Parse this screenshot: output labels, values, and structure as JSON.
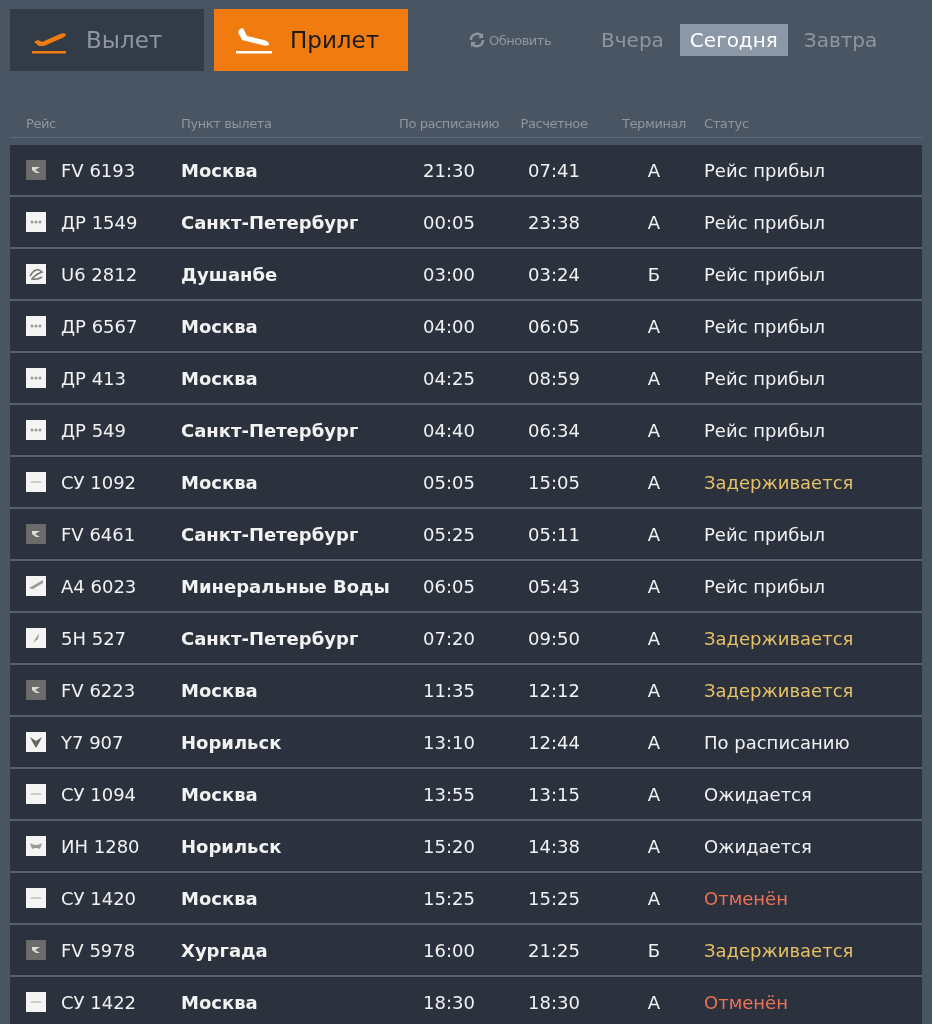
{
  "direction_tabs": [
    {
      "label": "Вылет",
      "kind": "departure",
      "selected": false
    },
    {
      "label": "Прилет",
      "kind": "arrival",
      "selected": true
    }
  ],
  "refresh": {
    "label": "Обновить"
  },
  "day_tabs": [
    {
      "label": "Вчера",
      "selected": false
    },
    {
      "label": "Сегодня",
      "selected": true
    },
    {
      "label": "Завтра",
      "selected": false
    }
  ],
  "table": {
    "columns": [
      "Рейс",
      "Пункт вылета",
      "По расписанию",
      "Расчетное",
      "Терминал",
      "Статус"
    ],
    "rows": [
      {
        "logo": {
          "kind": "chevron"
        },
        "flight": "FV 6193",
        "origin": "Москва",
        "scheduled": "21:30",
        "estimated": "07:41",
        "terminal": "А",
        "status": {
          "text": "Рейс прибыл",
          "kind": "arrived"
        }
      },
      {
        "logo": {
          "kind": "dots"
        },
        "flight": "ДР 1549",
        "origin": "Санкт-Петербург",
        "scheduled": "00:05",
        "estimated": "23:38",
        "terminal": "А",
        "status": {
          "text": "Рейс прибыл",
          "kind": "arrived"
        }
      },
      {
        "logo": {
          "kind": "swirl"
        },
        "flight": "U6 2812",
        "origin": "Душанбе",
        "scheduled": "03:00",
        "estimated": "03:24",
        "terminal": "Б",
        "status": {
          "text": "Рейс прибыл",
          "kind": "arrived"
        }
      },
      {
        "logo": {
          "kind": "dots"
        },
        "flight": "ДР 6567",
        "origin": "Москва",
        "scheduled": "04:00",
        "estimated": "06:05",
        "terminal": "А",
        "status": {
          "text": "Рейс прибыл",
          "kind": "arrived"
        }
      },
      {
        "logo": {
          "kind": "dots"
        },
        "flight": "ДР 413",
        "origin": "Москва",
        "scheduled": "04:25",
        "estimated": "08:59",
        "terminal": "А",
        "status": {
          "text": "Рейс прибыл",
          "kind": "arrived"
        }
      },
      {
        "logo": {
          "kind": "dots"
        },
        "flight": "ДР 549",
        "origin": "Санкт-Петербург",
        "scheduled": "04:40",
        "estimated": "06:34",
        "terminal": "А",
        "status": {
          "text": "Рейс прибыл",
          "kind": "arrived"
        }
      },
      {
        "logo": {
          "kind": "dash"
        },
        "flight": "СУ 1092",
        "origin": "Москва",
        "scheduled": "05:05",
        "estimated": "15:05",
        "terminal": "А",
        "status": {
          "text": "Задерживается",
          "kind": "delayed"
        }
      },
      {
        "logo": {
          "kind": "chevron"
        },
        "flight": "FV 6461",
        "origin": "Санкт-Петербург",
        "scheduled": "05:25",
        "estimated": "05:11",
        "terminal": "А",
        "status": {
          "text": "Рейс прибыл",
          "kind": "arrived"
        }
      },
      {
        "logo": {
          "kind": "wing"
        },
        "flight": "A4 6023",
        "origin": "Минеральные Воды",
        "scheduled": "06:05",
        "estimated": "05:43",
        "terminal": "А",
        "status": {
          "text": "Рейс прибыл",
          "kind": "arrived"
        }
      },
      {
        "logo": {
          "kind": "feather"
        },
        "flight": "5H 527",
        "origin": "Санкт-Петербург",
        "scheduled": "07:20",
        "estimated": "09:50",
        "terminal": "А",
        "status": {
          "text": "Задерживается",
          "kind": "delayed"
        }
      },
      {
        "logo": {
          "kind": "chevron"
        },
        "flight": "FV 6223",
        "origin": "Москва",
        "scheduled": "11:35",
        "estimated": "12:12",
        "terminal": "А",
        "status": {
          "text": "Задерживается",
          "kind": "delayed"
        }
      },
      {
        "logo": {
          "kind": "trident"
        },
        "flight": "Y7 907",
        "origin": "Норильск",
        "scheduled": "13:10",
        "estimated": "12:44",
        "terminal": "А",
        "status": {
          "text": "По расписанию",
          "kind": "scheduled"
        }
      },
      {
        "logo": {
          "kind": "dash"
        },
        "flight": "СУ 1094",
        "origin": "Москва",
        "scheduled": "13:55",
        "estimated": "13:15",
        "terminal": "А",
        "status": {
          "text": "Ожидается",
          "kind": "expected"
        }
      },
      {
        "logo": {
          "kind": "bird"
        },
        "flight": "ИН 1280",
        "origin": "Норильск",
        "scheduled": "15:20",
        "estimated": "14:38",
        "terminal": "А",
        "status": {
          "text": "Ожидается",
          "kind": "expected"
        }
      },
      {
        "logo": {
          "kind": "dash"
        },
        "flight": "СУ 1420",
        "origin": "Москва",
        "scheduled": "15:25",
        "estimated": "15:25",
        "terminal": "А",
        "status": {
          "text": "Отменён",
          "kind": "cancelled"
        }
      },
      {
        "logo": {
          "kind": "chevron"
        },
        "flight": "FV 5978",
        "origin": "Хургада",
        "scheduled": "16:00",
        "estimated": "21:25",
        "terminal": "Б",
        "status": {
          "text": "Задерживается",
          "kind": "delayed"
        }
      },
      {
        "logo": {
          "kind": "dash"
        },
        "flight": "СУ 1422",
        "origin": "Москва",
        "scheduled": "18:30",
        "estimated": "18:30",
        "terminal": "А",
        "status": {
          "text": "Отменён",
          "kind": "cancelled"
        }
      }
    ]
  }
}
